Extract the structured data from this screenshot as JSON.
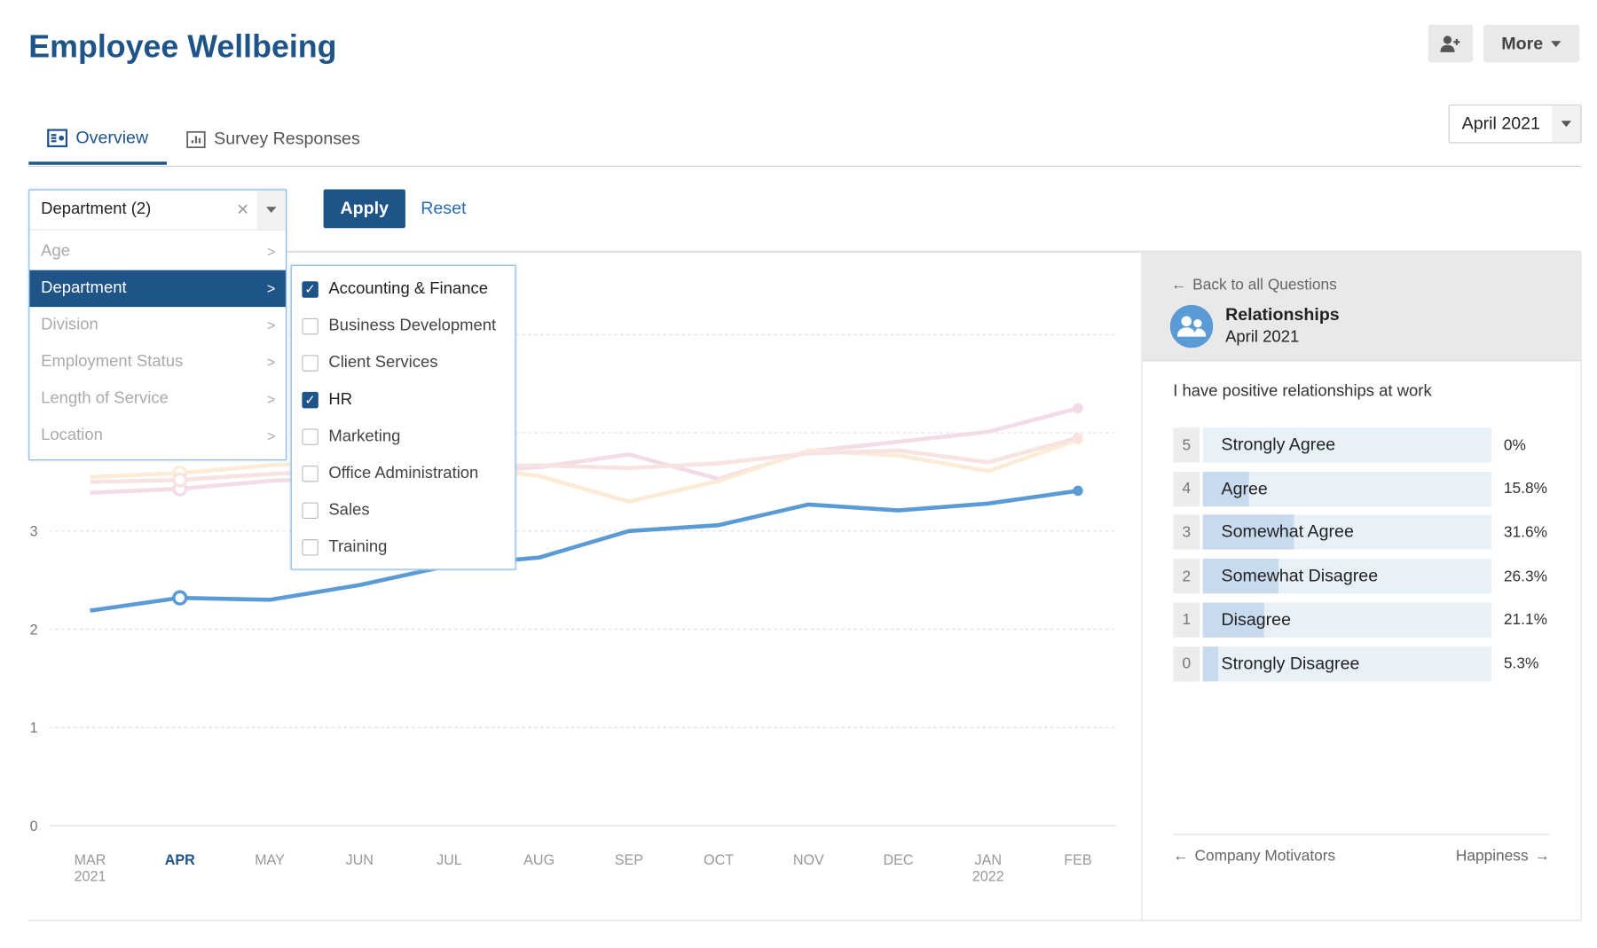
{
  "header": {
    "title": "Employee Wellbeing",
    "add_user_icon": "user-plus-icon",
    "more_label": "More"
  },
  "tabs": [
    {
      "label": "Overview",
      "icon": "overview-icon",
      "active": true
    },
    {
      "label": "Survey Responses",
      "icon": "bar-chart-icon",
      "active": false
    }
  ],
  "date_select": {
    "value": "April 2021"
  },
  "filter": {
    "selected_label": "Department (2)",
    "categories": [
      {
        "label": "Age"
      },
      {
        "label": "Department",
        "selected": true
      },
      {
        "label": "Division"
      },
      {
        "label": "Employment Status"
      },
      {
        "label": "Length of Service"
      },
      {
        "label": "Location"
      }
    ],
    "options": [
      {
        "label": "Accounting & Finance",
        "checked": true
      },
      {
        "label": "Business Development",
        "checked": false
      },
      {
        "label": "Client Services",
        "checked": false
      },
      {
        "label": "HR",
        "checked": true
      },
      {
        "label": "Marketing",
        "checked": false
      },
      {
        "label": "Office Administration",
        "checked": false
      },
      {
        "label": "Sales",
        "checked": false
      },
      {
        "label": "Training",
        "checked": false
      }
    ],
    "apply_label": "Apply",
    "reset_label": "Reset"
  },
  "chart_data": {
    "type": "line",
    "x": [
      "MAR 2021",
      "APR",
      "MAY",
      "JUN",
      "JUL",
      "AUG",
      "SEP",
      "OCT",
      "NOV",
      "DEC",
      "JAN 2022",
      "FEB"
    ],
    "x_ticks": [
      [
        "MAR",
        "2021"
      ],
      [
        "APR",
        ""
      ],
      [
        "MAY",
        ""
      ],
      [
        "JUN",
        ""
      ],
      [
        "JUL",
        ""
      ],
      [
        "AUG",
        ""
      ],
      [
        "SEP",
        ""
      ],
      [
        "OCT",
        ""
      ],
      [
        "NOV",
        ""
      ],
      [
        "DEC",
        ""
      ],
      [
        "JAN",
        "2022"
      ],
      [
        "FEB",
        ""
      ]
    ],
    "highlighted_x": "APR",
    "y_ticks": [
      0,
      1,
      2,
      3
    ],
    "ylim": [
      0,
      5
    ],
    "grid": true,
    "series": [
      {
        "values": [
          3.39,
          3.43,
          3.51,
          3.55,
          3.6,
          3.65,
          3.78,
          3.53,
          3.81,
          3.91,
          4.01,
          4.25
        ],
        "color": "#f3dbe8",
        "faded": true
      },
      {
        "values": [
          3.55,
          3.59,
          3.67,
          3.7,
          3.68,
          3.56,
          3.3,
          3.51,
          3.82,
          3.77,
          3.61,
          3.93
        ],
        "color": "#fcebd6",
        "faded": true
      },
      {
        "values": [
          3.5,
          3.52,
          3.58,
          3.62,
          3.65,
          3.67,
          3.64,
          3.69,
          3.79,
          3.82,
          3.7,
          3.95
        ],
        "color": "#f8e3e3",
        "faded": true
      },
      {
        "values": [
          2.19,
          2.32,
          2.3,
          2.45,
          2.65,
          2.73,
          3.0,
          3.06,
          3.27,
          3.21,
          3.28,
          3.41
        ],
        "color": "#5b9bd5",
        "faded": false
      }
    ]
  },
  "question": {
    "back_label": "Back to all Questions",
    "icon": "users-icon",
    "topic": "Relationships",
    "period": "April 2021",
    "text": "I have positive relationships at work",
    "answers": [
      {
        "score": "5",
        "label": "Strongly Agree",
        "pct": "0%",
        "value": 0
      },
      {
        "score": "4",
        "label": "Agree",
        "pct": "15.8%",
        "value": 15.8
      },
      {
        "score": "3",
        "label": "Somewhat Agree",
        "pct": "31.6%",
        "value": 31.6
      },
      {
        "score": "2",
        "label": "Somewhat Disagree",
        "pct": "26.3%",
        "value": 26.3
      },
      {
        "score": "1",
        "label": "Disagree",
        "pct": "21.1%",
        "value": 21.1
      },
      {
        "score": "0",
        "label": "Strongly Disagree",
        "pct": "5.3%",
        "value": 5.3
      }
    ],
    "prev_label": "Company Motivators",
    "next_label": "Happiness"
  },
  "colors": {
    "brand": "#1f5489",
    "accent": "#5b9bd5",
    "link": "#2a6cb0"
  }
}
